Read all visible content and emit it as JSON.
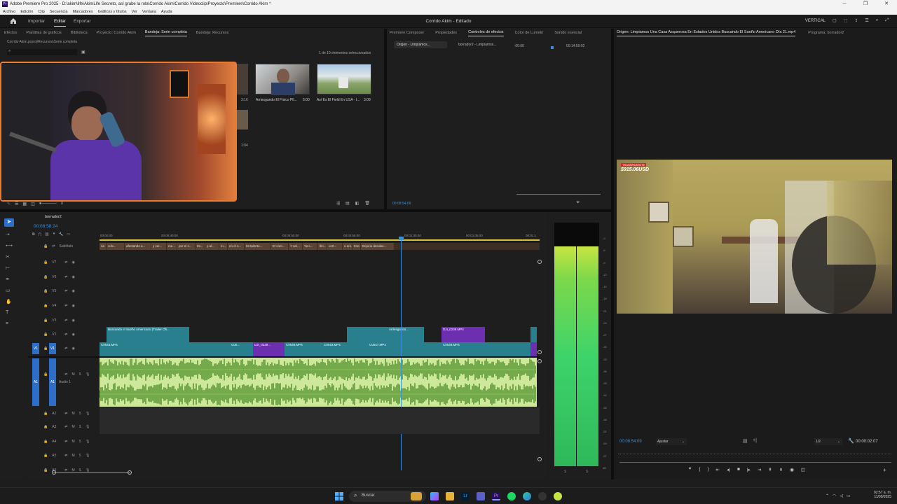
{
  "window": {
    "title": "Adobe Premiere Pro 2025 - D:\\akim\\life\\AkimLife Secreto, así grabe la rola\\Corrido Akim\\Corrido Videoclip\\Proyecto\\Premiere\\Corrido Akim *",
    "app_icon_text": "Pr",
    "controls": [
      "─",
      "❐",
      "✕"
    ]
  },
  "menu": [
    "Archivo",
    "Edición",
    "Clip",
    "Secuencia",
    "Marcadores",
    "Gráficos y títulos",
    "Ver",
    "Ventana",
    "Ayuda"
  ],
  "header": {
    "workspaces": [
      "Importar",
      "Editar",
      "Exportar"
    ],
    "active_workspace": "Editar",
    "project_title": "Corrido Akim - Editado",
    "right_label": "VERTICAL"
  },
  "project_panel": {
    "tabs": [
      "Efectos",
      "Plantillas de gráficos",
      "Biblioteca",
      "Proyecto: Corrido Akim",
      "Bandeja: Serie completa",
      "Bandeja: Recursos"
    ],
    "active_tab": "Bandeja: Serie completa",
    "path": "Corrido Akim.prproj\\Recursos\\Serie completa",
    "selection_info": "1 de 10 elementos seleccionados",
    "items": [
      {
        "name": "Arriesgando El Físico Pll...",
        "duration": "5:00"
      },
      {
        "name": "Así Es El Field En USA - I...",
        "duration": "3:09"
      }
    ],
    "partial_durations": [
      "3:16",
      "1:04"
    ]
  },
  "effects_panel": {
    "tabs": [
      "Premiere Composer",
      "Propiedades",
      "Controles de efectos",
      "Color de Lumetri",
      "Sonido esencial"
    ],
    "active_tab": "Controles de efectos",
    "source_chip": "Origen - Limpiamos...",
    "seq_chip": "borrador2 - Limpiamos...",
    "time_start": ":00:00",
    "time_end": "00:14:59:02",
    "current_time": "00:08:54:09"
  },
  "program_panel": {
    "tabs": [
      "Origen: Limpiamos Una Casa Asquerosa En Estados Unidos  Buscando El Sueño Americano Día 21.mp4",
      "Programa: borrador2"
    ],
    "overlay_badge": "TRANSPARENTE",
    "overlay_amount": "$915.06USD",
    "timecode": "00:08:54:09",
    "fit": "Ajustar",
    "quality": "1/2",
    "duration": "00:00:02:07"
  },
  "timeline": {
    "sequence_name": "borrador2",
    "timecode": "00:08:58:24",
    "ruler": [
      "00:00:00",
      "00:00:40:00",
      "00:00:50:00",
      "00:00:55:00",
      "00:01:00:00",
      "00:01:05:00",
      "00:01:1"
    ],
    "subtitle_track_label": "Subtítulo",
    "subtitles": [
      "ria",
      "volv...",
      "afectando a...",
      "y ver...",
      "me...",
      "por el s...",
      "Mi...",
      "y al...",
      "m...",
      "en el n...",
      "Mi talento...",
      "El com...",
      "Y así...",
      "Ya s...",
      "llm...",
      "cort...",
      "o em...",
      "Ese...",
      "Deja la desolac..."
    ],
    "video_tracks": [
      "V7",
      "V6",
      "V5",
      "V4",
      "V3",
      "V2",
      "V1"
    ],
    "audio_tracks": [
      "A1",
      "A2",
      "A3",
      "A4",
      "A5",
      "A6"
    ],
    "audio_label": "Audio 1",
    "v2_clips": [
      "Buscando el Sueño Americano (Trailer Ofi...",
      "Arriesgando...",
      "DJI_0239.MP4"
    ],
    "v1_clips": [
      "C0043.MP4",
      "C00...",
      "DJI_0239...",
      "C0046.MP4",
      "C0043.MP4",
      "C0047.MP4",
      "C0049.MP4"
    ],
    "meter_db": [
      "-3",
      "-6",
      "-9",
      "-12",
      "-15",
      "-18",
      "-21",
      "-24",
      "-27",
      "-30",
      "-33",
      "-36",
      "-39",
      "-42",
      "-45",
      "-48",
      "-51",
      "-54",
      "-57",
      "dB"
    ],
    "meter_bottom": [
      "S",
      "S"
    ]
  },
  "taskbar": {
    "search_placeholder": "Buscar",
    "time": "02:57 a. m.",
    "date": "11/09/2025"
  },
  "colors": {
    "video_clip": "#2a7f8f",
    "video_clip_alt": "#6b2fb0",
    "audio_wave": "#9ad06a",
    "meter_green": "#3ed46b",
    "playhead": "#3b8fd9",
    "accent_blue": "#2d6ec9"
  }
}
